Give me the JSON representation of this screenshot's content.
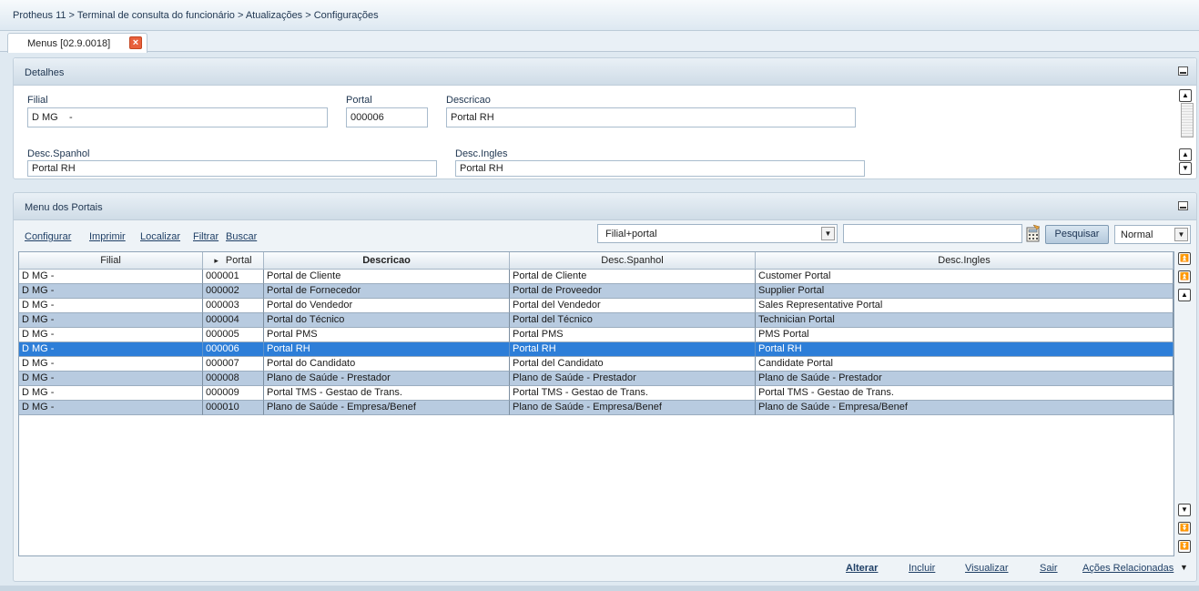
{
  "breadcrumb": "Protheus 11 > Terminal de consulta do funcionário > Atualizações > Configurações",
  "tab": {
    "label": "Menus [02.9.0018]",
    "close_symbol": "×"
  },
  "details": {
    "title": "Detalhes",
    "fields": {
      "filial": {
        "label": "Filial",
        "value": "D MG    -"
      },
      "portal": {
        "label": "Portal",
        "value": "000006"
      },
      "descricao": {
        "label": "Descricao",
        "value": "Portal RH"
      },
      "desc_spanhol": {
        "label": "Desc.Spanhol",
        "value": "Portal RH"
      },
      "desc_ingles": {
        "label": "Desc.Ingles",
        "value": "Portal RH"
      }
    }
  },
  "portals": {
    "title": "Menu dos Portais",
    "toolbar": {
      "configurar": "Configurar",
      "imprimir": "Imprimir",
      "localizar": "Localizar",
      "filtrar": "Filtrar",
      "buscar": "Buscar",
      "index_option": "Filial+portal",
      "search_value": "",
      "pesquisar": "Pesquisar",
      "view_option": "Normal"
    },
    "columns": [
      "Filial",
      "Portal",
      "Descricao",
      "Desc.Spanhol",
      "Desc.Ingles"
    ],
    "sort_marker": "▸",
    "rows": [
      [
        "D MG    -",
        "000001",
        "Portal de Cliente",
        "Portal de Cliente",
        "Customer Portal"
      ],
      [
        "D MG    -",
        "000002",
        "Portal de Fornecedor",
        "Portal de Proveedor",
        "Supplier Portal"
      ],
      [
        "D MG    -",
        "000003",
        "Portal do Vendedor",
        "Portal del Vendedor",
        "Sales Representative Portal"
      ],
      [
        "D MG    -",
        "000004",
        "Portal do Técnico",
        "Portal del Técnico",
        "Technician Portal"
      ],
      [
        "D MG    -",
        "000005",
        "Portal PMS",
        "Portal PMS",
        "PMS Portal"
      ],
      [
        "D MG    -",
        "000006",
        "Portal RH",
        "Portal RH",
        "Portal RH"
      ],
      [
        "D MG    -",
        "000007",
        "Portal do Candidato",
        "Portal del Candidato",
        "Candidate Portal"
      ],
      [
        "D MG    -",
        "000008",
        "Plano de Saúde - Prestador",
        "Plano de Saúde - Prestador",
        "Plano de Saúde - Prestador"
      ],
      [
        "D MG    -",
        "000009",
        "Portal TMS - Gestao de Trans.",
        "Portal TMS - Gestao de Trans.",
        "Portal TMS - Gestao de Trans."
      ],
      [
        "D MG    -",
        "000010",
        "Plano de Saúde - Empresa/Benef",
        "Plano de Saúde - Empresa/Benef",
        "Plano de Saúde - Empresa/Benef"
      ]
    ],
    "selected_row": 5
  },
  "actions": {
    "alterar": "Alterar",
    "incluir": "Incluir",
    "visualizar": "Visualizar",
    "sair": "Sair",
    "relacionadas": "Ações Relacionadas"
  },
  "colors": {
    "selected_row": "#2d7ed8",
    "alt_row": "#b8cbe0",
    "link": "#1f3f66",
    "close_button": "#e8603c"
  },
  "icons": [
    "close-icon",
    "minimize-icon",
    "scroll-up-icon",
    "scroll-down-icon",
    "calculator-icon",
    "dropdown-arrow-icon",
    "sort-arrow-icon"
  ]
}
